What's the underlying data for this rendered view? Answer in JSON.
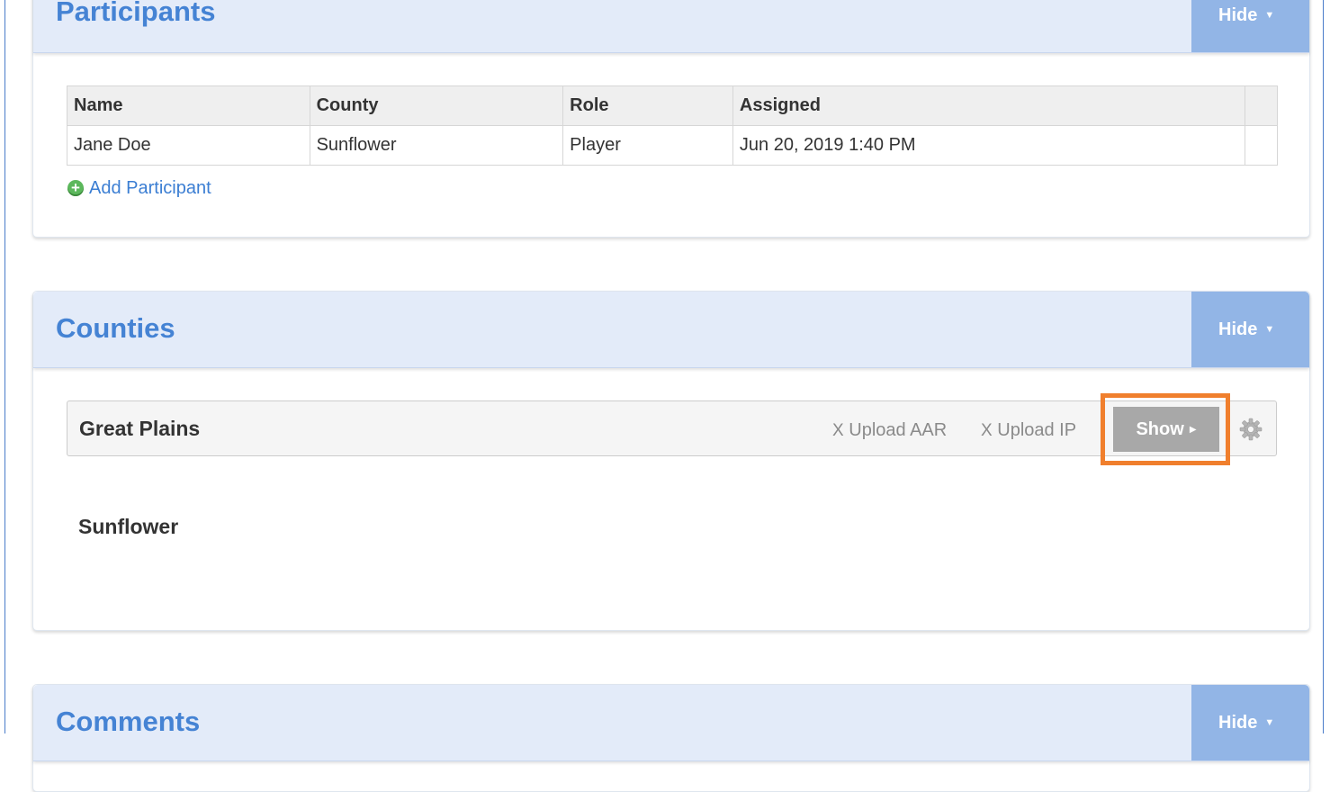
{
  "participants": {
    "title": "Participants",
    "hide_label": "Hide",
    "columns": [
      "Name",
      "County",
      "Role",
      "Assigned",
      ""
    ],
    "rows": [
      {
        "name": "Jane Doe",
        "county": "Sunflower",
        "role": "Player",
        "assigned": "Jun 20, 2019 1:40 PM"
      }
    ],
    "add_label": "Add Participant"
  },
  "counties": {
    "title": "Counties",
    "hide_label": "Hide",
    "county_name": "Great Plains",
    "upload_aar_label": "Upload AAR",
    "upload_ip_label": "Upload IP",
    "x_mark": "X",
    "show_label": "Show",
    "sub_county": "Sunflower"
  },
  "comments": {
    "title": "Comments",
    "hide_label": "Hide"
  },
  "colors": {
    "accent": "#4583d4",
    "hide_button": "#92b5e6",
    "highlight": "#f07f2d"
  }
}
